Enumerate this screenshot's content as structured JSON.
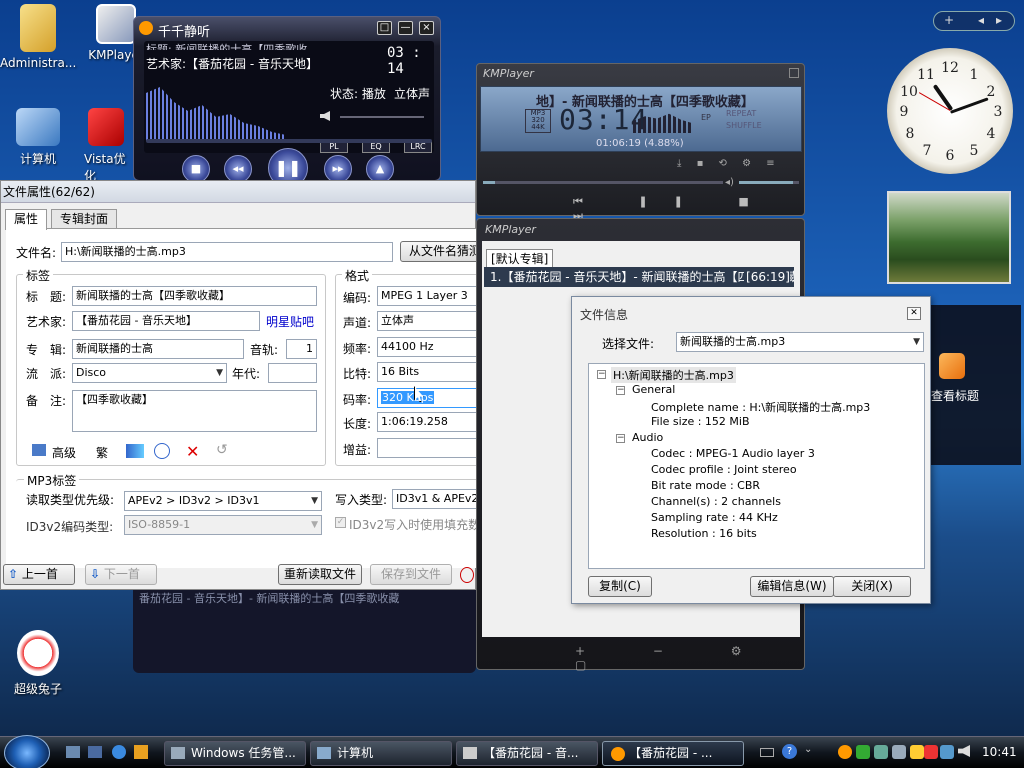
{
  "desktop": {
    "icons": [
      {
        "label": "Administra..."
      },
      {
        "label": "KMPlayer"
      },
      {
        "label": "计算机"
      },
      {
        "label": "Vista优化"
      },
      {
        "label": "超级兔子"
      }
    ],
    "rss_gadget_label": "查看标题",
    "clock_numbers": [
      "12",
      "1",
      "2",
      "3",
      "4",
      "5",
      "6",
      "7",
      "8",
      "9",
      "10",
      "11"
    ]
  },
  "ttplayer": {
    "title": "千千静听",
    "scroll_text": "标题: 新闻联播的士高【四季歌收",
    "artist_line": "艺术家:【番茄花园 - 音乐天地】",
    "time": "03 : 14",
    "status": "状态: 播放",
    "stereo": "立体声",
    "buttons": {
      "pl": "PL",
      "eq": "EQ",
      "lrc": "LRC"
    },
    "window_buttons": {
      "mini": "□",
      "min": "—",
      "close": "×"
    }
  },
  "file_props": {
    "title": "文件属性(62/62)",
    "tabs": [
      "属性",
      "专辑封面"
    ],
    "filename_label": "文件名:",
    "filename": "H:\\新闻联播的士高.mp3",
    "guess_button": "从文件名猜测",
    "tag_group": "标签",
    "title_label": "标　题:",
    "title_value": "新闻联播的士高【四季歌收藏】",
    "artist_label": "艺术家:",
    "artist_value": "【番茄花园 - 音乐天地】",
    "star_link": "明星贴吧",
    "album_label": "专　辑:",
    "album_value": "新闻联播的士高",
    "track_label": "音轨:",
    "track_value": "1",
    "genre_label": "流　派:",
    "genre_value": "Disco",
    "year_label": "年代:",
    "year_value": "",
    "comment_label": "备　注:",
    "comment_value": "【四季歌收藏】",
    "advanced_label": "高级",
    "tool_label": "繁",
    "format_group": "格式",
    "encoding_label": "编码:",
    "encoding_value": "MPEG 1 Layer 3",
    "channel_label": "声道:",
    "channel_value": "立体声",
    "freq_label": "频率:",
    "freq_value": "44100 Hz",
    "bits_label": "比特:",
    "bits_value": "16 Bits",
    "bitrate_label": "码率:",
    "bitrate_value": "320 Kbps",
    "length_label": "长度:",
    "length_value": "1:06:19.258",
    "gain_label": "增益:",
    "gain_value": "",
    "mp3_group": "MP3标签",
    "read_priority_label": "读取类型优先级:",
    "read_priority_value": "APEv2 > ID3v2 > ID3v1",
    "write_type_label": "写入类型:",
    "write_type_value": "ID3v1 & APEv2",
    "id3v2_enc_label": "ID3v2编码类型:",
    "id3v2_enc_value": "ISO-8859-1",
    "id3v2_pad_label": "ID3v2写入时使用填充数",
    "prev_button": "上一首",
    "next_button": "下一首",
    "reload_button": "重新读取文件",
    "save_button": "保存到文件"
  },
  "kmplayer": {
    "title": "KMPlayer",
    "scroll_title": "地】- 新闻联播的士高【四季歌收藏】",
    "time": "03:14",
    "position": "01:06:19 (4.88%)",
    "info_labels": [
      "MP3",
      "320",
      "44K"
    ],
    "side_labels": [
      "REPEAT",
      "SHUFFLE"
    ],
    "ep_label": "EP",
    "volume_fraction": 0.9,
    "seek_fraction": 0.05
  },
  "kmplaylist": {
    "title": "KMPlayer",
    "tab": "[默认专辑]",
    "item": "1.【番茄花园 - 音乐天地】- 新闻联播的士高【四季歌收藏】",
    "item_duration": "[66:19]",
    "bg_text": "番茄花园 - 音乐天地】- 新闻联播的士高【四季歌收藏"
  },
  "file_info": {
    "title": "文件信息",
    "close_x": "✕",
    "select_label": "选择文件:",
    "select_value": "新闻联播的士高.mp3",
    "tree": {
      "root": "H:\\新闻联播的士高.mp3",
      "general": "General",
      "complete_name": "Complete name : H:\\新闻联播的士高.mp3",
      "file_size": "File size : 152 MiB",
      "audio": "Audio",
      "codec": "Codec : MPEG-1 Audio layer 3",
      "codec_profile": "Codec profile : Joint stereo",
      "bit_rate_mode": "Bit rate mode : CBR",
      "channels": "Channel(s) : 2 channels",
      "sampling_rate": "Sampling rate : 44 KHz",
      "resolution": "Resolution : 16 bits"
    },
    "copy_button": "复制(C)",
    "edit_button": "编辑信息(W)",
    "close_button": "关闭(X)"
  },
  "taskbar": {
    "items": [
      "Windows 任务管...",
      "计算机",
      "【番茄花园 - 音...",
      "【番茄花园 - ..."
    ],
    "clock": "10:41"
  },
  "sidebar_controls": {
    "add": "+",
    "prev": "◂",
    "next": "▸"
  }
}
